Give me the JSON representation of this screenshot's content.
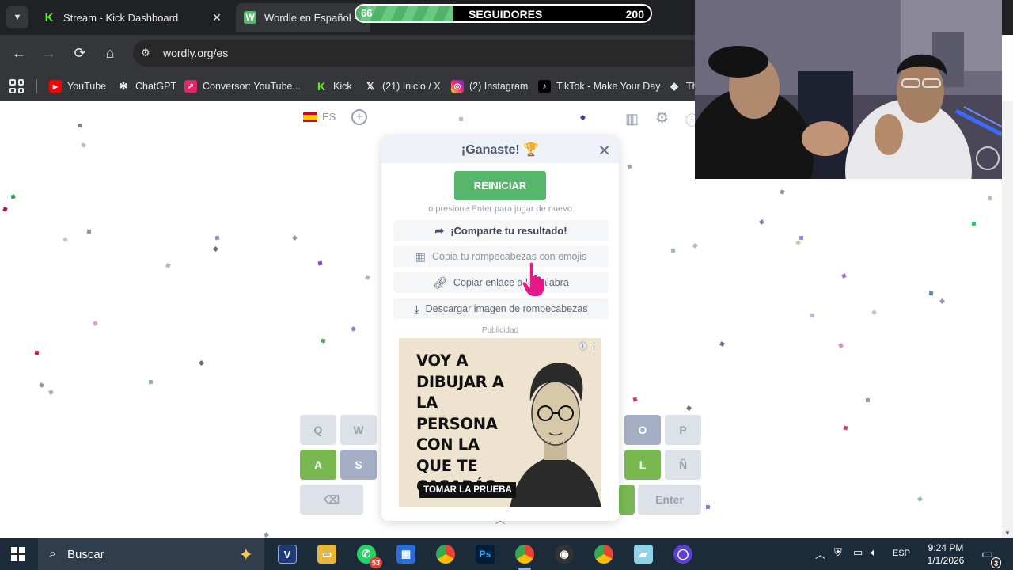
{
  "browser": {
    "tabs": [
      {
        "title": "Stream - Kick Dashboard",
        "icon": "kick-icon"
      },
      {
        "title": "Wordle en Español - Ju",
        "icon": "wordly-icon"
      }
    ],
    "url": "wordly.org/es",
    "bookmarks": [
      {
        "label": "YouTube",
        "icon": "youtube-icon"
      },
      {
        "label": "ChatGPT",
        "icon": "chatgpt-icon"
      },
      {
        "label": "Conversor: YouTube...",
        "icon": "converter-icon"
      },
      {
        "label": "Kick",
        "icon": "kick-icon"
      },
      {
        "label": "(21) Inicio / X",
        "icon": "x-icon"
      },
      {
        "label": "(2) Instagram",
        "icon": "instagram-icon"
      },
      {
        "label": "TikTok - Make Your Day",
        "icon": "tiktok-icon"
      },
      {
        "label": "Th",
        "icon": "diamond-icon"
      }
    ]
  },
  "follower_goal": {
    "current": "66",
    "label": "SEGUIDORES",
    "target": "200",
    "progress_fraction": 0.33
  },
  "page": {
    "language": "ES",
    "keyboard": {
      "row1": [
        "Q",
        "W",
        "O",
        "P"
      ],
      "row2": [
        "A",
        "S",
        "L",
        "Ñ"
      ],
      "row3": [
        "⌫",
        "Enter"
      ]
    }
  },
  "modal": {
    "title": "¡Ganaste! 🏆",
    "restart_label": "REINICIAR",
    "hint": "o presione Enter para jugar de nuevo",
    "share_label": "¡Comparte tu resultado!",
    "copy_label": "Copia tu rompecabezas con emojis",
    "link_label": "Copiar enlace a la palabra",
    "download_label": "Descargar imagen de rompecabezas",
    "ad_label": "Publicidad",
    "ad": {
      "headline": "VOY A DIBUJAR A LA PERSONA CON LA QUE TE CASARÁS",
      "cta": "TOMAR LA PRUEBA"
    }
  },
  "taskbar": {
    "search_placeholder": "Buscar",
    "whatsapp_badge": "53",
    "language": "ESP",
    "time": "9:24 PM",
    "date": "1/1/2026",
    "notifications": "3"
  },
  "colors": {
    "accent_green": "#56b66a",
    "key_green": "#79b851",
    "key_gray": "#a4aec4",
    "cursor_pink": "#e6188a"
  }
}
